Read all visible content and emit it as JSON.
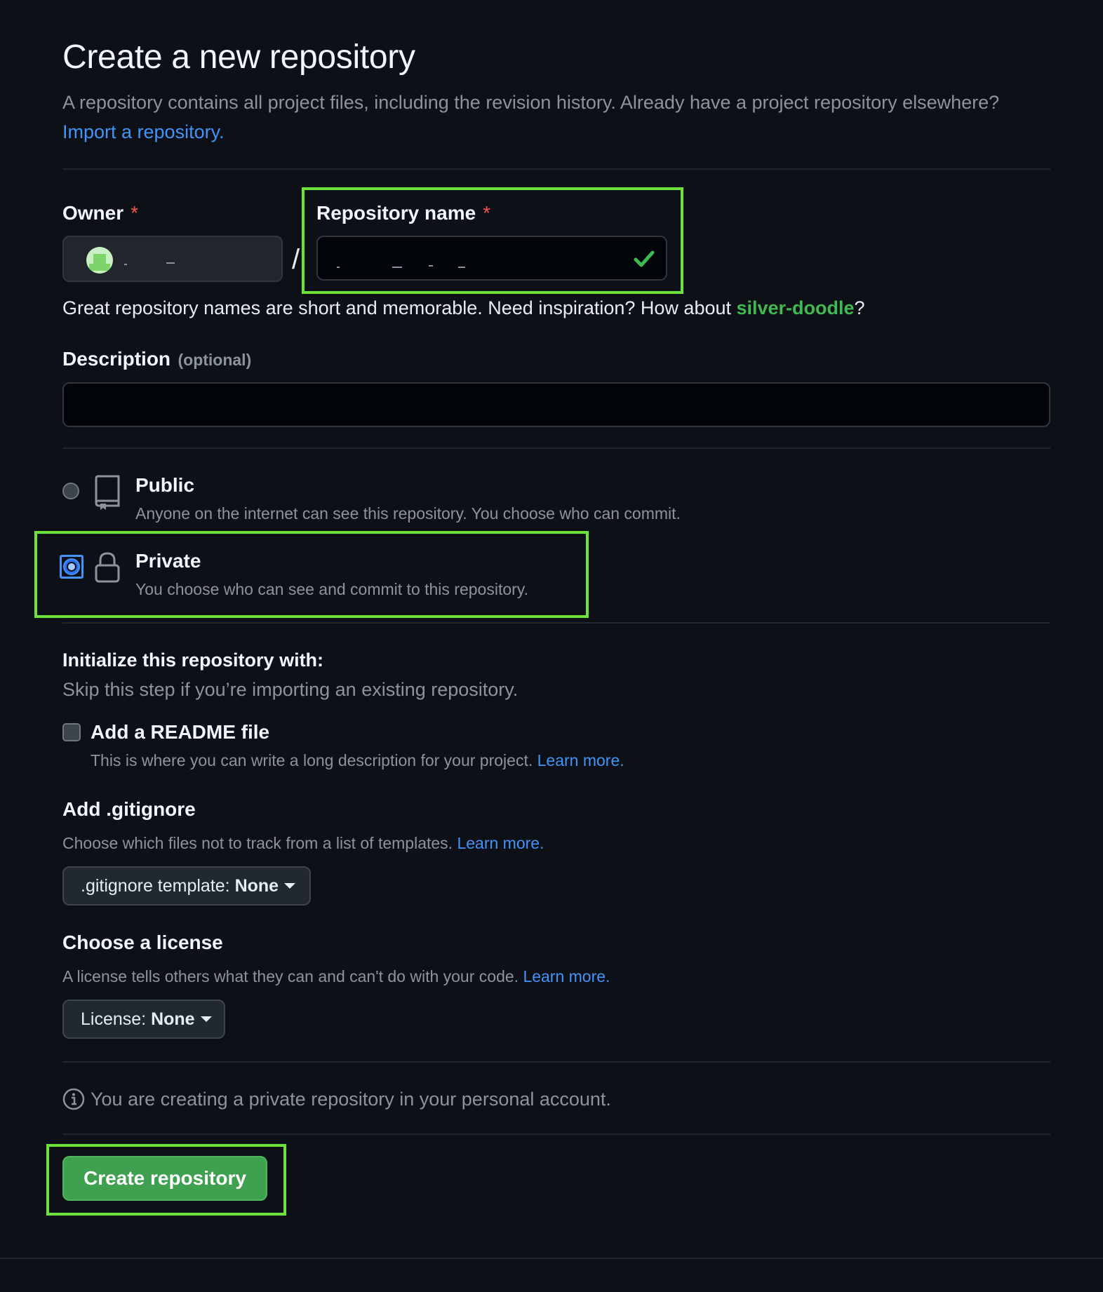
{
  "header": {
    "title": "Create a new repository",
    "subtitle": "A repository contains all project files, including the revision history. Already have a project repository elsewhere?",
    "import_link": "Import a repository."
  },
  "owner": {
    "label": "Owner",
    "required_mark": "*"
  },
  "separator": "/",
  "repo_name": {
    "label": "Repository name",
    "required_mark": "*",
    "valid_icon": "check-icon"
  },
  "name_hint": {
    "prefix": "Great repository names are short and memorable. Need inspiration? How about ",
    "suggestion": "silver-doodle",
    "suffix": "?"
  },
  "description": {
    "label": "Description",
    "optional": "(optional)",
    "value": ""
  },
  "visibility": {
    "public": {
      "title": "Public",
      "desc": "Anyone on the internet can see this repository. You choose who can commit.",
      "icon": "repo-icon",
      "selected": false
    },
    "private": {
      "title": "Private",
      "desc": "You choose who can see and commit to this repository.",
      "icon": "lock-icon",
      "selected": true
    }
  },
  "init": {
    "heading": "Initialize this repository with:",
    "subheading": "Skip this step if you’re importing an existing repository.",
    "readme": {
      "label": "Add a README file",
      "desc": "This is where you can write a long description for your project.",
      "learn": "Learn more.",
      "checked": false
    }
  },
  "gitignore": {
    "heading": "Add .gitignore",
    "desc": "Choose which files not to track from a list of templates.",
    "learn": "Learn more.",
    "button_prefix": ".gitignore template: ",
    "button_value": "None"
  },
  "license": {
    "heading": "Choose a license",
    "desc": "A license tells others what they can and can't do with your code.",
    "learn": "Learn more.",
    "button_prefix": "License: ",
    "button_value": "None"
  },
  "notice": {
    "icon": "info-icon",
    "text": "You are creating a private repository in your personal account."
  },
  "submit": {
    "label": "Create repository"
  },
  "colors": {
    "background": "#0d1117",
    "link": "#4493f8",
    "primary_button": "#3fa14f",
    "highlight": "#6be33a",
    "suggestion": "#3fb950"
  }
}
